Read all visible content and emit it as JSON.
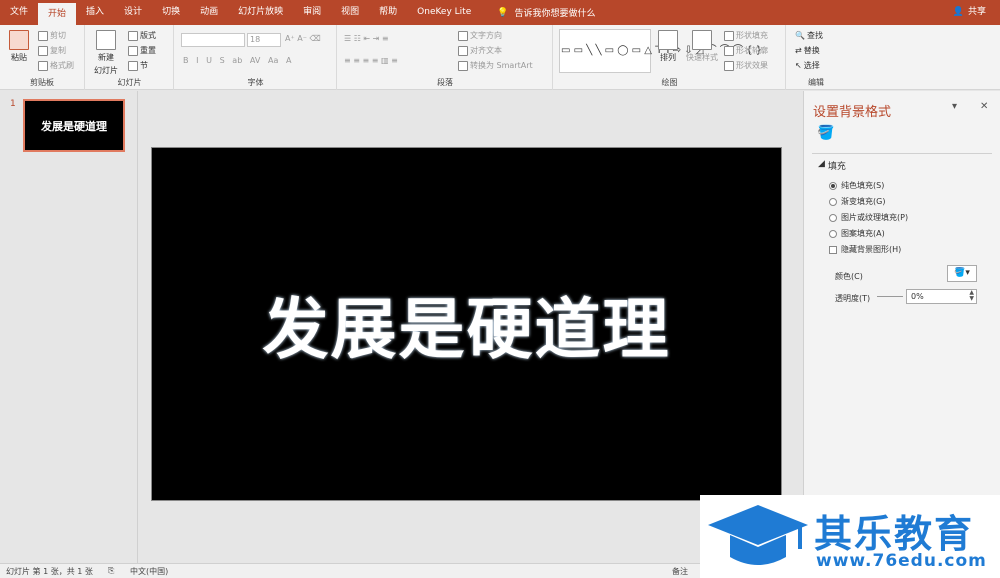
{
  "tabs": [
    {
      "label": "文件",
      "active": false
    },
    {
      "label": "开始",
      "active": true
    },
    {
      "label": "插入",
      "active": false
    },
    {
      "label": "设计",
      "active": false
    },
    {
      "label": "切换",
      "active": false
    },
    {
      "label": "动画",
      "active": false
    },
    {
      "label": "幻灯片放映",
      "active": false
    },
    {
      "label": "审阅",
      "active": false
    },
    {
      "label": "视图",
      "active": false
    },
    {
      "label": "帮助",
      "active": false
    },
    {
      "label": "OneKey Lite",
      "active": false
    }
  ],
  "tell_me": "告诉我你想要做什么",
  "share": "共享",
  "ribbon": {
    "clipboard": {
      "label": "剪贴板",
      "paste": "粘贴",
      "cut": "剪切",
      "copy": "复制",
      "format_painter": "格式刷"
    },
    "slides": {
      "label": "幻灯片",
      "new_slide": "新建",
      "new_slide2": "幻灯片",
      "layout": "版式",
      "reset": "重置",
      "section": "节"
    },
    "font": {
      "label": "字体",
      "font_size": "18"
    },
    "paragraph": {
      "label": "段落",
      "text_direction": "文字方向",
      "align_text": "对齐文本",
      "smartart": "转换为 SmartArt"
    },
    "drawing": {
      "label": "绘图",
      "arrange": "排列",
      "quick_styles": "快速样式",
      "shape_fill": "形状填充",
      "shape_outline": "形状轮廓",
      "shape_effects": "形状效果"
    },
    "editing": {
      "label": "编辑",
      "find": "查找",
      "replace": "替换",
      "select": "选择"
    }
  },
  "slides": [
    {
      "number": "1",
      "title": "发展是硬道理"
    }
  ],
  "slide": {
    "text": "发展是硬道理"
  },
  "format_pane": {
    "title": "设置背景格式",
    "section": "填充",
    "options": [
      {
        "label": "纯色填充(S)",
        "type": "radio",
        "checked": true
      },
      {
        "label": "渐变填充(G)",
        "type": "radio",
        "checked": false
      },
      {
        "label": "图片或纹理填充(P)",
        "type": "radio",
        "checked": false
      },
      {
        "label": "图案填充(A)",
        "type": "radio",
        "checked": false
      },
      {
        "label": "隐藏背景图形(H)",
        "type": "checkbox",
        "checked": false
      }
    ],
    "color_label": "颜色(C)",
    "transparency_label": "透明度(T)",
    "transparency_value": "0%"
  },
  "status": {
    "slide_info": "幻灯片 第 1 张，共 1 张",
    "language": "中文(中国)",
    "notes": "备注"
  },
  "watermark": {
    "cn": "其乐教育",
    "url": "www.76edu.com"
  }
}
